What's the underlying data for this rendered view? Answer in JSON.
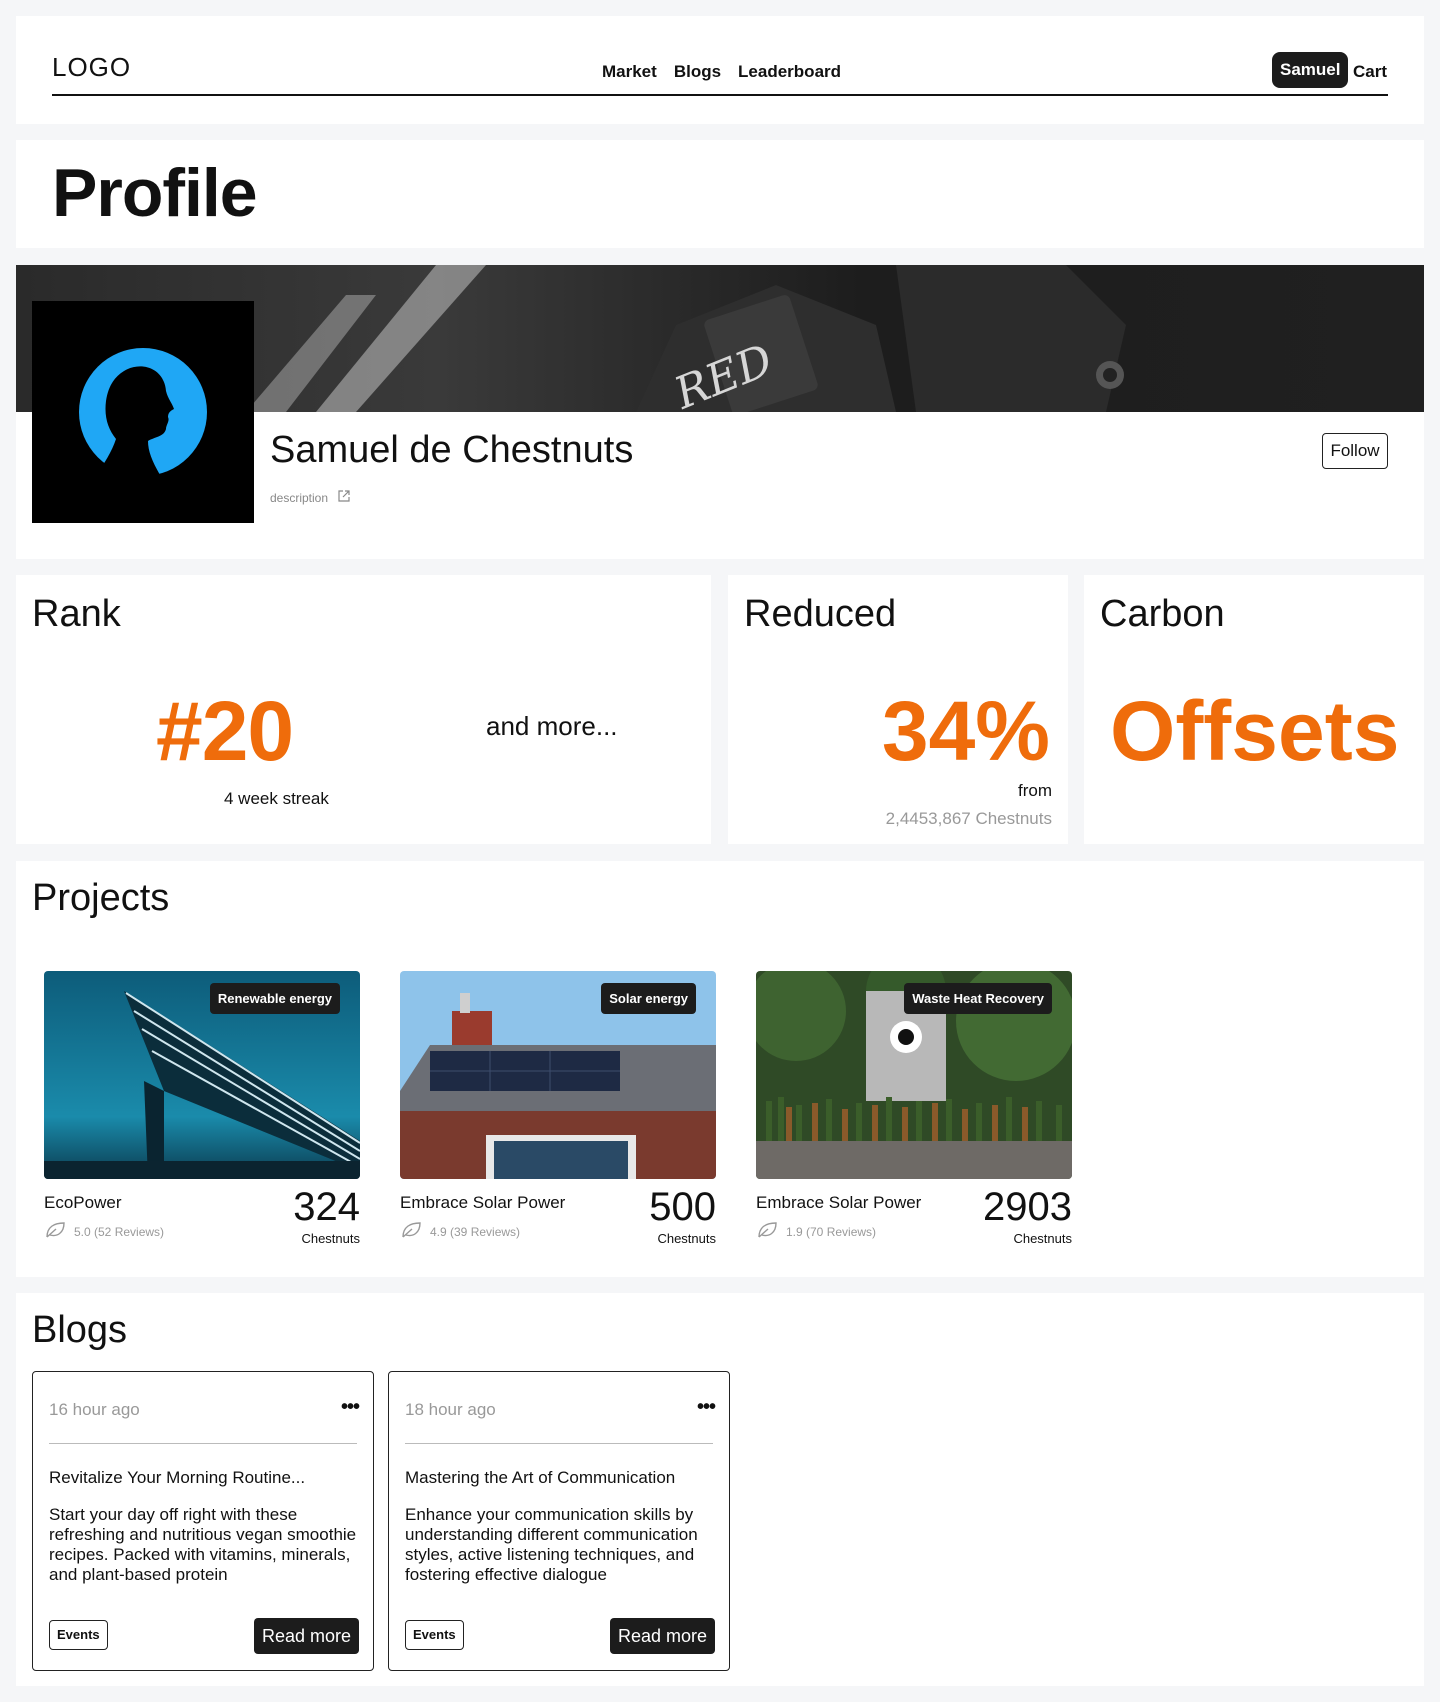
{
  "header": {
    "logo": "LOGO",
    "nav": [
      "Market",
      "Blogs",
      "Leaderboard"
    ],
    "user": "Samuel",
    "cart": "Cart"
  },
  "page_title": "Profile",
  "profile": {
    "name": "Samuel de Chestnuts",
    "description": "description",
    "follow_label": "Follow"
  },
  "stats": {
    "rank": {
      "title": "Rank",
      "value": "#20",
      "streak": "4 week streak",
      "more": "and more..."
    },
    "reduced": {
      "title": "Reduced",
      "value": "34%",
      "from": "from",
      "chestnuts": "2,4453,867 Chestnuts"
    },
    "carbon": {
      "title": "Carbon",
      "value": "Offsets"
    }
  },
  "projects": {
    "title": "Projects",
    "items": [
      {
        "tag": "Renewable energy",
        "name": "EcoPower",
        "rating": "5.0 (52 Reviews)",
        "value": "324",
        "unit": "Chestnuts"
      },
      {
        "tag": "Solar energy",
        "name": "Embrace Solar Power",
        "rating": "4.9 (39 Reviews)",
        "value": "500",
        "unit": "Chestnuts"
      },
      {
        "tag": "Waste Heat Recovery",
        "name": "Embrace Solar Power",
        "rating": "1.9 (70 Reviews)",
        "value": "2903",
        "unit": "Chestnuts"
      }
    ]
  },
  "blogs": {
    "title": "Blogs",
    "items": [
      {
        "time": "16 hour ago",
        "title": "Revitalize Your Morning Routine...",
        "body": "Start your day off right with these refreshing and nutritious vegan smoothie recipes. Packed with vitamins, minerals, and plant-based protein",
        "tag": "Events",
        "read_more": "Read more"
      },
      {
        "time": "18 hour ago",
        "title": "Mastering the Art of Communication",
        "body": "Enhance your communication skills by understanding different communication styles, active listening techniques, and fostering effective dialogue",
        "tag": "Events",
        "read_more": "Read more"
      }
    ]
  },
  "colors": {
    "accent": "#ef6c0b",
    "dark": "#1c1c1c",
    "avatar_ring": "#1fa7f5"
  },
  "icons": [
    "external-link-icon",
    "leaf-icon",
    "more-dots-icon"
  ]
}
